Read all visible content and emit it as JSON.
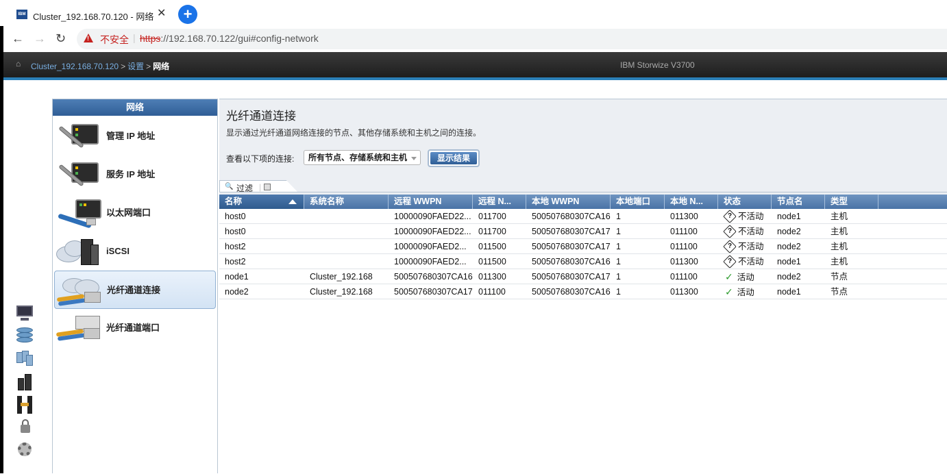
{
  "browser": {
    "tab_title": "Cluster_192.168.70.120 - 网络",
    "favicon_text": "IBM",
    "security_label": "不安全",
    "url_scheme": "https",
    "url_rest": "://192.168.70.122/gui#config-network"
  },
  "header": {
    "breadcrumb": [
      "Cluster_192.168.70.120",
      "设置",
      "网络"
    ],
    "product": "IBM Storwize V3700"
  },
  "nav": {
    "title": "网络",
    "items": [
      {
        "label": "管理 IP 地址",
        "icon": "management-ip-icon"
      },
      {
        "label": "服务 IP 地址",
        "icon": "service-ip-icon"
      },
      {
        "label": "以太网端口",
        "icon": "ethernet-port-icon"
      },
      {
        "label": "iSCSI",
        "icon": "iscsi-icon"
      },
      {
        "label": "光纤通道连接",
        "icon": "fibre-channel-connectivity-icon",
        "selected": true
      },
      {
        "label": "光纤通道端口",
        "icon": "fibre-channel-port-icon"
      }
    ]
  },
  "content": {
    "title": "光纤通道连接",
    "description": "显示通过光纤通道网络连接的节点、其他存储系统和主机之间的连接。",
    "view_label": "查看以下项的连接:",
    "view_select": "所有节点、存储系统和主机",
    "show_button": "显示结果",
    "filter_label": "过滤"
  },
  "table": {
    "columns": [
      "名称",
      "系统名称",
      "远程 WWPN",
      "远程 N...",
      "本地 WWPN",
      "本地端口",
      "本地 N...",
      "状态",
      "节点名",
      "类型"
    ],
    "rows": [
      {
        "name": "host0",
        "system": "",
        "remote_wwpn": "10000090FAED22...",
        "remote_n": "011700",
        "local_wwpn": "500507680307CA16",
        "local_port": "1",
        "local_n": "011300",
        "state": "不活动",
        "state_type": "inactive",
        "node": "node1",
        "type": "主机"
      },
      {
        "name": "host0",
        "system": "",
        "remote_wwpn": "10000090FAED22...",
        "remote_n": "011700",
        "local_wwpn": "500507680307CA17",
        "local_port": "1",
        "local_n": "011100",
        "state": "不活动",
        "state_type": "inactive",
        "node": "node2",
        "type": "主机"
      },
      {
        "name": "host2",
        "system": "",
        "remote_wwpn": "10000090FAED2...",
        "remote_n": "011500",
        "local_wwpn": "500507680307CA17",
        "local_port": "1",
        "local_n": "011100",
        "state": "不活动",
        "state_type": "inactive",
        "node": "node2",
        "type": "主机"
      },
      {
        "name": "host2",
        "system": "",
        "remote_wwpn": "10000090FAED2...",
        "remote_n": "011500",
        "local_wwpn": "500507680307CA16",
        "local_port": "1",
        "local_n": "011300",
        "state": "不活动",
        "state_type": "inactive",
        "node": "node1",
        "type": "主机"
      },
      {
        "name": "node1",
        "system": "Cluster_192.168",
        "remote_wwpn": "500507680307CA16",
        "remote_n": "011300",
        "local_wwpn": "500507680307CA17",
        "local_port": "1",
        "local_n": "011100",
        "state": "活动",
        "state_type": "active",
        "node": "node2",
        "type": "节点"
      },
      {
        "name": "node2",
        "system": "Cluster_192.168",
        "remote_wwpn": "500507680307CA17",
        "remote_n": "011100",
        "local_wwpn": "500507680307CA16",
        "local_port": "1",
        "local_n": "011300",
        "state": "活动",
        "state_type": "active",
        "node": "node1",
        "type": "节点"
      }
    ]
  },
  "colors": {
    "accent": "#2f5e96",
    "header_bg": "#1e1e1e",
    "insecure": "#c5221f",
    "active": "#2a9a2a"
  }
}
